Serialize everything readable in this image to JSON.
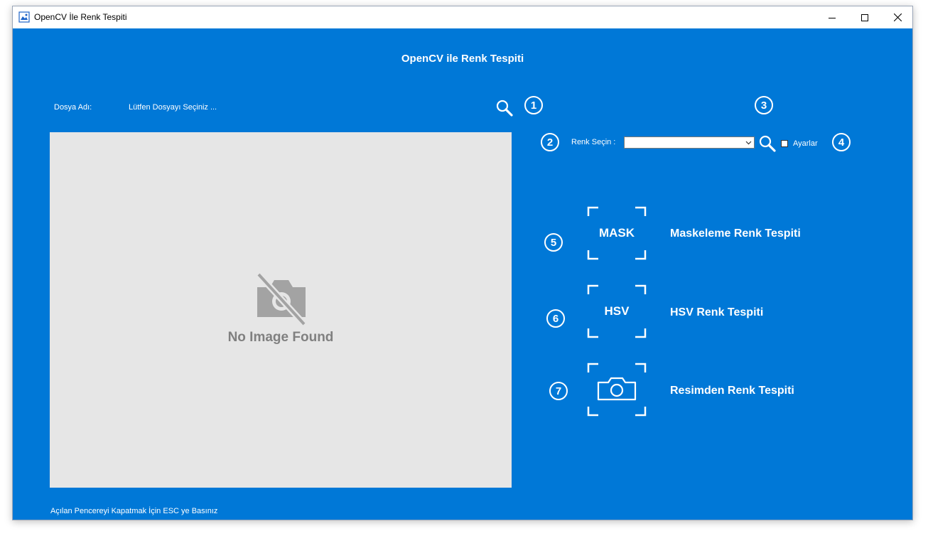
{
  "window": {
    "title": "OpenCV İle Renk Tespiti",
    "controls": [
      "minimize-icon",
      "maximize-icon",
      "close-icon"
    ]
  },
  "header": {
    "title": "OpenCV ile Renk Tespiti"
  },
  "file": {
    "label": "Dosya Adı:",
    "value": "Lütfen Dosyayı Seçiniz ...",
    "search_icon": "search-icon"
  },
  "image_panel": {
    "placeholder_text": "No Image Found",
    "icon": "no-camera-icon"
  },
  "color_select": {
    "label": "Renk Seçin :",
    "value": "",
    "search_icon": "search-icon"
  },
  "settings": {
    "label": "Ayarlar",
    "checked": false
  },
  "markers": [
    "1",
    "2",
    "3",
    "4",
    "5",
    "6",
    "7"
  ],
  "actions": [
    {
      "tile_text": "MASK",
      "label": "Maskeleme Renk Tespiti"
    },
    {
      "tile_text": "HSV",
      "label": "HSV Renk Tespiti"
    },
    {
      "tile_icon": "camera-icon",
      "label": "Resimden Renk Tespiti"
    }
  ],
  "footer": {
    "text": "Açılan Pencereyi Kapatmak İçin ESC ye Basınız"
  },
  "colors": {
    "background": "#0078d7",
    "image_panel": "#e6e6e6",
    "text": "#ffffff"
  }
}
